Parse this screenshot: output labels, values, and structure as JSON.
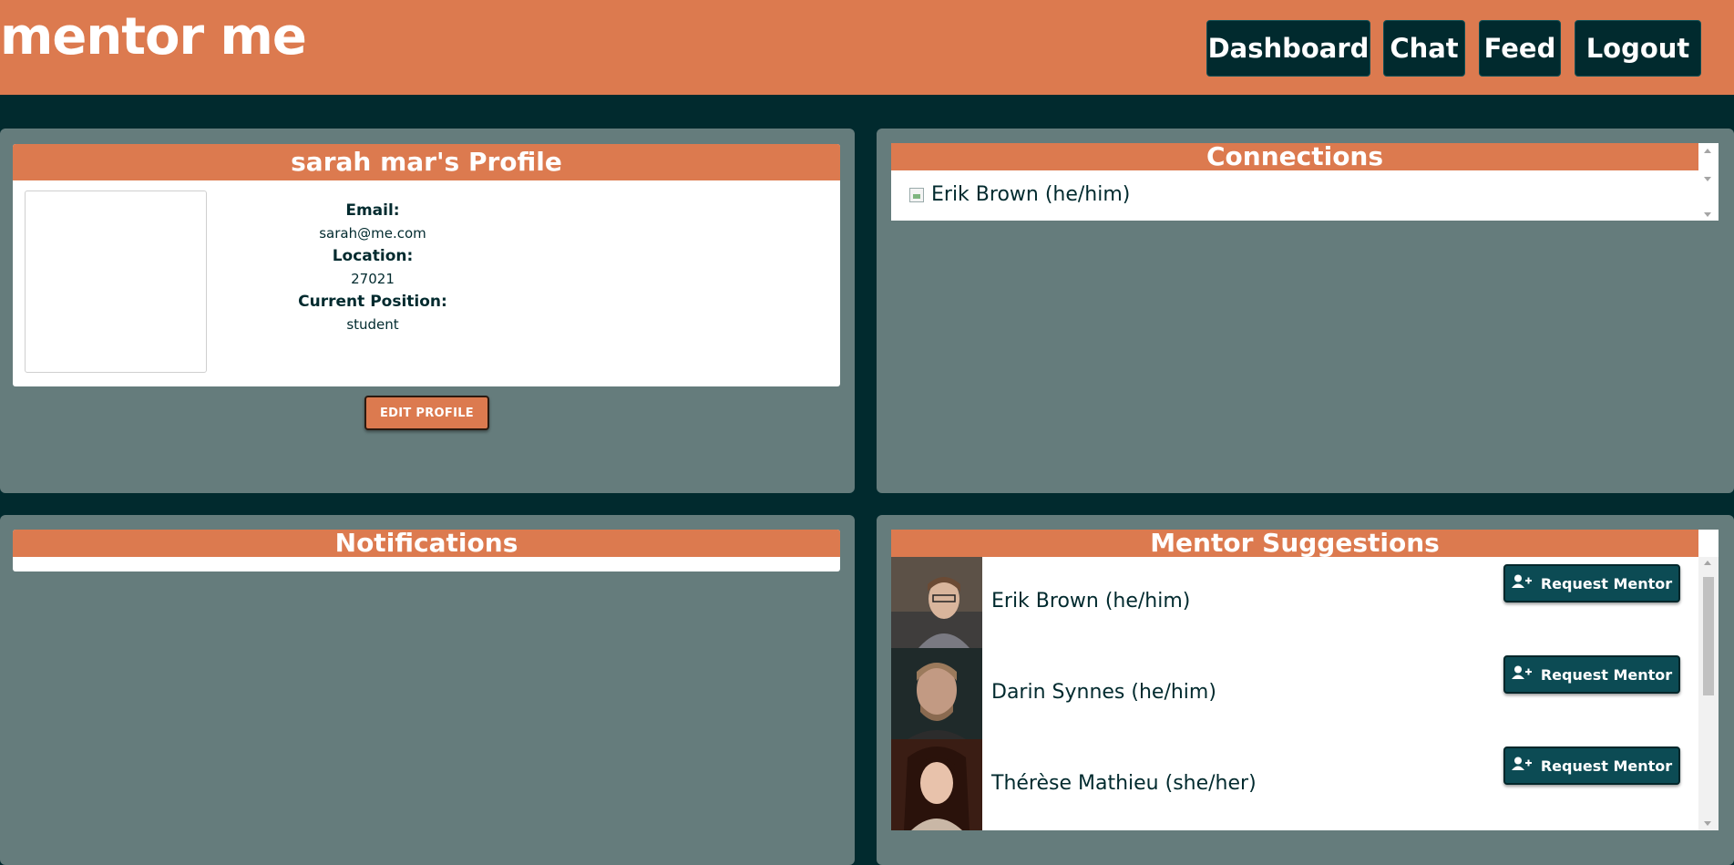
{
  "header": {
    "brand": "mentor me",
    "nav": {
      "dashboard": "Dashboard",
      "chat": "Chat",
      "feed": "Feed",
      "logout": "Logout"
    }
  },
  "profile": {
    "title": "sarah mar's Profile",
    "email_label": "Email:",
    "email": "sarah@me.com",
    "location_label": "Location:",
    "location": "27021",
    "position_label": "Current Position:",
    "position": "student",
    "edit_button": "EDIT PROFILE"
  },
  "connections": {
    "title": "Connections",
    "items": [
      {
        "name": "Erik Brown (he/him)"
      }
    ]
  },
  "notifications": {
    "title": "Notifications"
  },
  "mentors": {
    "title": "Mentor Suggestions",
    "request_label": "Request Mentor",
    "items": [
      {
        "name": "Erik Brown (he/him)"
      },
      {
        "name": "Darin Synnes (he/him)"
      },
      {
        "name": "Thérèse Mathieu (she/her)"
      }
    ]
  },
  "colors": {
    "accent": "#dc7a4f",
    "dark": "#012a2e",
    "panel": "#657c7c",
    "button": "#0c4b54"
  }
}
